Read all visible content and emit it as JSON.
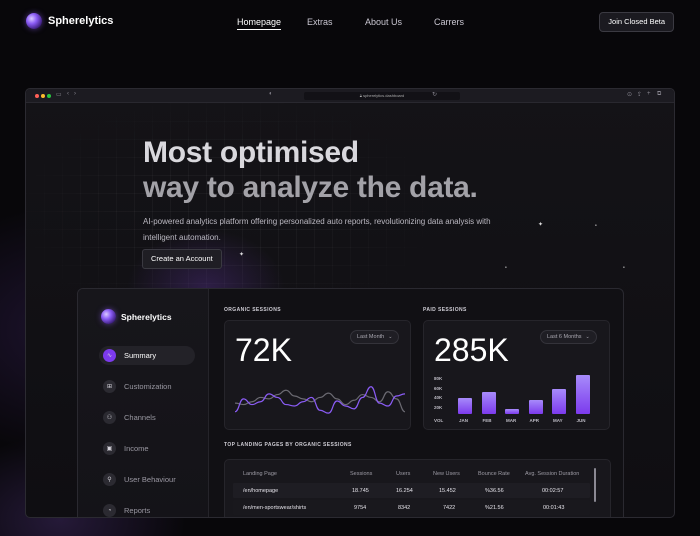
{
  "brand": {
    "name": "Spherelytics"
  },
  "nav": {
    "links": [
      "Homepage",
      "Extras",
      "About Us",
      "Carrers"
    ],
    "active_index": 0,
    "cta_label": "Join Closed Beta"
  },
  "browser": {
    "url": "spherelytics.dashboard"
  },
  "hero": {
    "title_line1": "Most optimised",
    "title_line2": "way to analyze the data.",
    "subtitle": "AI-powered analytics platform offering personalized auto reports, revolutionizing data analysis with intelligent automation.",
    "cta_label": "Create an Account"
  },
  "dashboard": {
    "brand": "Spherelytics",
    "sidebar": [
      {
        "label": "Summary",
        "icon": "trend-icon",
        "active": true
      },
      {
        "label": "Customization",
        "icon": "grid-icon",
        "active": false
      },
      {
        "label": "Channels",
        "icon": "channels-icon",
        "active": false
      },
      {
        "label": "Income",
        "icon": "wallet-icon",
        "active": false
      },
      {
        "label": "User Behaviour",
        "icon": "user-icon",
        "active": false
      },
      {
        "label": "Reports",
        "icon": "pie-icon",
        "active": false
      }
    ],
    "organic": {
      "label": "ORGANIC SESSIONS",
      "value": "72K",
      "range": "Last Month"
    },
    "paid": {
      "label": "PAID SESSIONS",
      "value": "285K",
      "range": "Last 6 Months"
    },
    "table": {
      "label": "TOP LANDING PAGES BY ORGANIC SESSIONS",
      "columns": [
        "Landing Page",
        "Sessions",
        "Users",
        "New Users",
        "Bounce Rate",
        "Avg. Session Duration"
      ],
      "rows": [
        [
          "/en/homepage",
          "18.745",
          "16.254",
          "15.452",
          "%36.56",
          "00:02:57"
        ],
        [
          "/en/men-sportswear/shirts",
          "9754",
          "8342",
          "7422",
          "%21.56",
          "00:01:43"
        ]
      ]
    }
  },
  "chart_data": [
    {
      "type": "line",
      "title": "ORGANIC SESSIONS",
      "x": [
        0,
        1,
        2,
        3,
        4,
        5,
        6,
        7,
        8,
        9,
        10,
        11,
        12,
        13,
        14,
        15,
        16,
        17,
        18,
        19,
        20
      ],
      "series": [
        {
          "values": [
            20,
            38,
            30,
            34,
            45,
            40,
            30,
            28,
            34,
            40,
            22,
            18,
            35,
            28,
            24,
            40,
            55,
            32,
            28,
            42,
            45
          ],
          "color": "#8b5cf6"
        },
        {
          "values": [
            32,
            30,
            34,
            40,
            38,
            44,
            50,
            42,
            38,
            34,
            40,
            46,
            38,
            30,
            36,
            44,
            40,
            34,
            48,
            38,
            20
          ],
          "color": "#6b6a72"
        }
      ],
      "ylim": [
        0,
        70
      ],
      "grid": false
    },
    {
      "type": "bar",
      "title": "PAID SESSIONS",
      "categories": [
        "JAN",
        "FEB",
        "MAR",
        "APR",
        "MAY",
        "JUN"
      ],
      "values": [
        37,
        52,
        12,
        33,
        60,
        93
      ],
      "y_ticks": [
        "80K",
        "60K",
        "40K",
        "20K"
      ],
      "ylabel": "VOL",
      "ylim": [
        0,
        100
      ]
    }
  ]
}
